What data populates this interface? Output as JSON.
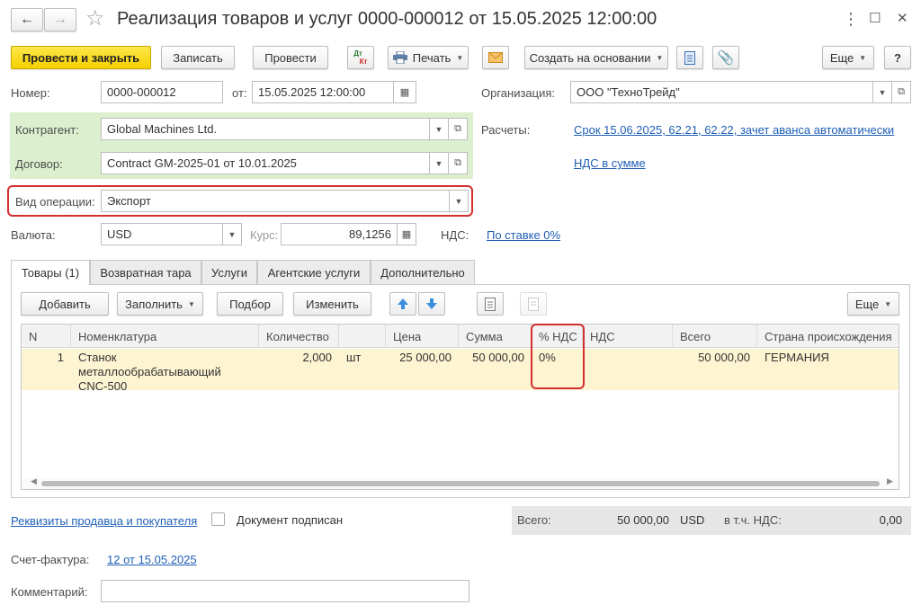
{
  "window": {
    "title": "Реализация товаров и услуг 0000-000012 от 15.05.2025 12:00:00",
    "back": "←",
    "forward": "→",
    "star": "☆",
    "more_vert": "⋮",
    "maximize": "☐",
    "close": "✕"
  },
  "toolbar": {
    "post_close": "Провести и закрыть",
    "save": "Записать",
    "post": "Провести",
    "dtkt_top": "Дт",
    "dtkt_bottom": "Кт",
    "print": "Печать",
    "create_based": "Создать на основании",
    "more": "Еще",
    "help": "?"
  },
  "header": {
    "number_label": "Номер:",
    "number_value": "0000-000012",
    "date_label": "от:",
    "date_value": "15.05.2025 12:00:00",
    "org_label": "Организация:",
    "org_value": "ООО \"ТехноТрейд\"",
    "contractor_label": "Контрагент:",
    "contractor_value": "Global Machines Ltd.",
    "contract_label": "Договор:",
    "contract_value": "Contract GM-2025-01 от 10.01.2025",
    "settlements_label": "Расчеты:",
    "settlements_link": "Срок 15.06.2025, 62.21, 62.22, зачет аванса автоматически",
    "vat_link": "НДС в сумме",
    "operation_label": "Вид операции:",
    "operation_value": "Экспорт",
    "currency_label": "Валюта:",
    "currency_value": "USD",
    "rate_label": "Курс:",
    "rate_value": "89,1256",
    "vat_label": "НДС:",
    "vat_rate_link": "По ставке 0%"
  },
  "tabs": [
    "Товары (1)",
    "Возвратная тара",
    "Услуги",
    "Агентские услуги",
    "Дополнительно"
  ],
  "table_toolbar": {
    "add": "Добавить",
    "fill": "Заполнить",
    "select": "Подбор",
    "change": "Изменить",
    "more": "Еще"
  },
  "table": {
    "columns": [
      "N",
      "Номенклатура",
      "Количество",
      "",
      "Цена",
      "Сумма",
      "% НДС",
      "НДС",
      "Всего",
      "Страна происхождения"
    ],
    "rows": [
      {
        "n": "1",
        "item_line1": "Станок металлообрабатывающий",
        "item_line2": "CNC-500",
        "qty": "2,000",
        "unit": "шт",
        "price": "25 000,00",
        "sum": "50 000,00",
        "vat_rate": "0%",
        "vat": "",
        "total": "50 000,00",
        "country": "ГЕРМАНИЯ"
      }
    ]
  },
  "footer": {
    "requisites_link": "Реквизиты продавца и покупателя",
    "signed_label": "Документ подписан",
    "total_label": "Всего:",
    "total_value": "50 000,00",
    "total_currency": "USD",
    "vat_incl_label": "в т.ч. НДС:",
    "vat_incl_value": "0,00",
    "invoice_label": "Счет-фактура:",
    "invoice_link": "12 от 15.05.2025",
    "comment_label": "Комментарий:",
    "comment_value": ""
  },
  "colors": {
    "primary_button": "#f5d000",
    "highlight_red": "#d32f2f",
    "green_panel": "#dcefcf",
    "selected_row": "#fdf4d2",
    "link": "#1f5fb6"
  }
}
